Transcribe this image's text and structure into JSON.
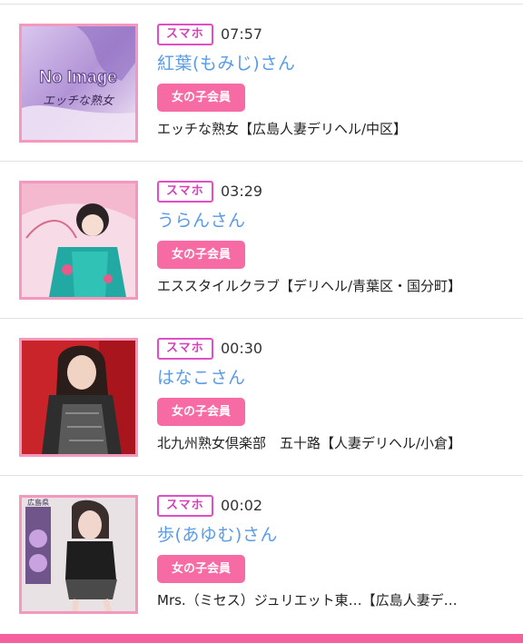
{
  "colors": {
    "accent_pink": "#f76ba4",
    "name_blue": "#5a9be6",
    "device_badge_magenta": "#d63fb9",
    "bottom_bar": "#f4619c"
  },
  "entries": [
    {
      "device": "スマホ",
      "time": "07:57",
      "name": "紅葉(もみじ)さん",
      "member_label": "女の子会員",
      "shop": "エッチな熟女【広島人妻デリヘル/中区】",
      "photo": {
        "type": "no-image-placeholder",
        "line1": "No Image",
        "line2": "エッチな熟女"
      }
    },
    {
      "device": "スマホ",
      "time": "03:29",
      "name": "うらんさん",
      "member_label": "女の子会員",
      "shop": "エススタイルクラブ【デリヘル/青葉区・国分町】",
      "photo": {
        "type": "profile-photo"
      }
    },
    {
      "device": "スマホ",
      "time": "00:30",
      "name": "はなこさん",
      "member_label": "女の子会員",
      "shop": "北九州熟女倶楽部　五十路【人妻デリヘル/小倉】",
      "photo": {
        "type": "profile-photo"
      }
    },
    {
      "device": "スマホ",
      "time": "00:02",
      "name": "歩(あゆむ)さん",
      "member_label": "女の子会員",
      "shop": "Mrs.（ミセス）ジュリエット東…【広島人妻デ…",
      "photo": {
        "type": "profile-photo",
        "caption": "広島県"
      }
    }
  ]
}
